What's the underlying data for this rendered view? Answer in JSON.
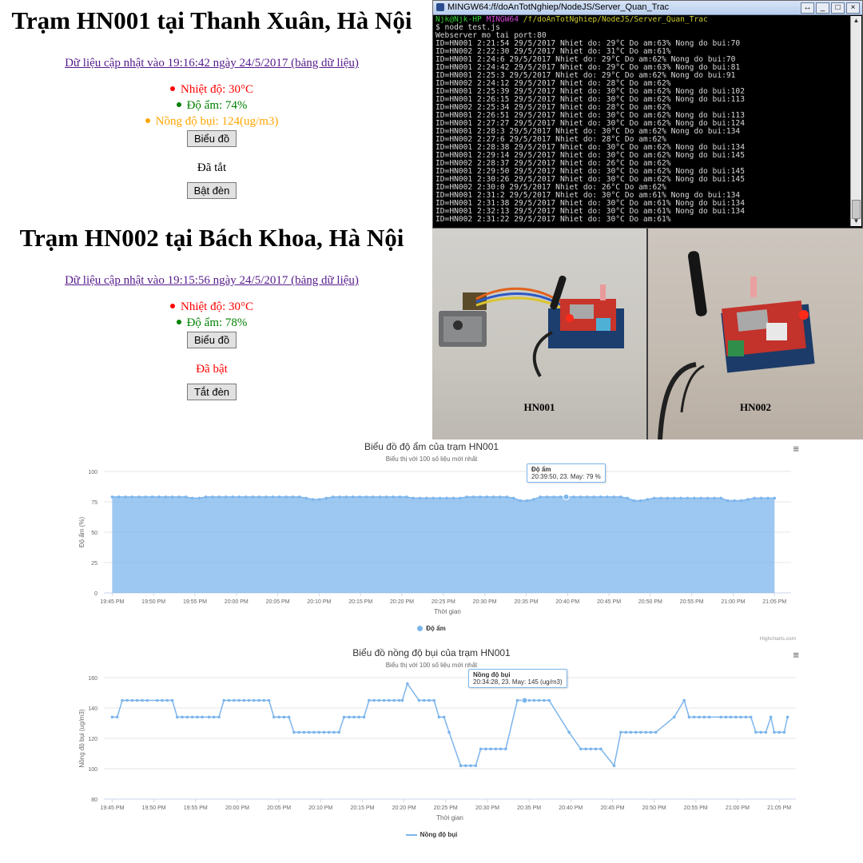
{
  "stations": [
    {
      "title": "Trạm HN001 tại Thanh Xuân, Hà Nội",
      "update_text": "Dữ liệu cập nhật vào 19:16:42 ngày 24/5/2017 (bảng dữ liệu)",
      "metrics": [
        {
          "text": "Nhiệt độ: 30°C",
          "color": "#ff0000"
        },
        {
          "text": "Độ ẩm: 74%",
          "color": "#008000"
        },
        {
          "text": "Nồng độ bụi: 124(ug/m3)",
          "color": "#ffa500"
        }
      ],
      "chart_button": "Biểu đồ",
      "state_text": "Đã tắt",
      "state_color": "#000000",
      "toggle_button": "Bật đèn"
    },
    {
      "title": "Trạm HN002 tại Bách Khoa, Hà Nội",
      "update_text": "Dữ liệu cập nhật vào 19:15:56 ngày 24/5/2017 (bảng dữ liệu)",
      "metrics": [
        {
          "text": "Nhiệt độ: 30°C",
          "color": "#ff0000"
        },
        {
          "text": "Độ ẩm: 78%",
          "color": "#008000"
        }
      ],
      "chart_button": "Biểu đồ",
      "state_text": "Đã bật",
      "state_color": "#ff0000",
      "toggle_button": "Tắt đèn"
    }
  ],
  "terminal": {
    "title": "MINGW64:/f/doAnTotNghiep/NodeJS/Server_Quan_Trac",
    "prompt_user": "Njk@Njk-HP",
    "prompt_host": "MINGW64",
    "prompt_path": "/f/doAnTotNghiep/NodeJS/Server_Quan_Trac",
    "command": "$ node test.js",
    "lines": [
      "Webserver mo tai port:80",
      "ID=HN001 2:21:54 29/5/2017 Nhiet do: 29°C Do am:63% Nong do bui:70",
      "ID=HN002 2:22:30 29/5/2017 Nhiet do: 31°C Do am:61%",
      "ID=HN001 2:24:6 29/5/2017 Nhiet do: 29°C Do am:62% Nong do bui:70",
      "ID=HN001 2:24:42 29/5/2017 Nhiet do: 29°C Do am:63% Nong do bui:81",
      "ID=HN001 2:25:3 29/5/2017 Nhiet do: 29°C Do am:62% Nong do bui:91",
      "ID=HN002 2:24:12 29/5/2017 Nhiet do: 28°C Do am:62%",
      "ID=HN001 2:25:39 29/5/2017 Nhiet do: 30°C Do am:62% Nong do bui:102",
      "ID=HN001 2:26:15 29/5/2017 Nhiet do: 30°C Do am:62% Nong do bui:113",
      "ID=HN002 2:25:34 29/5/2017 Nhiet do: 28°C Do am:62%",
      "ID=HN001 2:26:51 29/5/2017 Nhiet do: 30°C Do am:62% Nong do bui:113",
      "ID=HN001 2:27:27 29/5/2017 Nhiet do: 30°C Do am:62% Nong do bui:124",
      "ID=HN001 2:28:3 29/5/2017 Nhiet do: 30°C Do am:62% Nong do bui:134",
      "ID=HN002 2:27:6 29/5/2017 Nhiet do: 28°C Do am:62%",
      "ID=HN001 2:28:38 29/5/2017 Nhiet do: 30°C Do am:62% Nong do bui:134",
      "ID=HN001 2:29:14 29/5/2017 Nhiet do: 30°C Do am:62% Nong do bui:145",
      "ID=HN002 2:28:37 29/5/2017 Nhiet do: 26°C Do am:62%",
      "ID=HN001 2:29:50 29/5/2017 Nhiet do: 30°C Do am:62% Nong do bui:145",
      "ID=HN001 2:30:26 29/5/2017 Nhiet do: 30°C Do am:62% Nong do bui:145",
      "ID=HN002 2:30:0 29/5/2017 Nhiet do: 26°C Do am:62%",
      "ID=HN001 2:31:2 29/5/2017 Nhiet do: 30°C Do am:61% Nong do bui:134",
      "ID=HN001 2:31:38 29/5/2017 Nhiet do: 30°C Do am:61% Nong do bui:134",
      "ID=HN001 2:32:13 29/5/2017 Nhiet do: 30°C Do am:61% Nong do bui:134",
      "ID=HN002 2:31:22 29/5/2017 Nhiet do: 30°C Do am:61%"
    ]
  },
  "photos": {
    "label_1": "HN001",
    "label_2": "HN002"
  },
  "chart_data": [
    {
      "type": "area",
      "title": "Biểu đồ độ ẩm của trạm HN001",
      "subtitle": "Biểu thị với 100 số liệu mới nhất",
      "xlabel": "Thời gian",
      "ylabel": "Độ ẩm (%)",
      "ylim": [
        0,
        100
      ],
      "yticks": [
        0,
        25,
        50,
        75,
        100
      ],
      "xlim": [
        "19:44",
        "21:07"
      ],
      "xticks": [
        "19:45 PM",
        "19:50 PM",
        "19:55 PM",
        "20:00 PM",
        "20:05 PM",
        "20:10 PM",
        "20:15 PM",
        "20:20 PM",
        "20:25 PM",
        "20:30 PM",
        "20:35 PM",
        "20:40 PM",
        "20:45 PM",
        "20:50 PM",
        "20:55 PM",
        "21:00 PM",
        "21:05 PM"
      ],
      "series": [
        {
          "name": "Độ ẩm",
          "color": "#7cb5ec",
          "start": "19:45",
          "end": "21:05",
          "values": [
            79,
            79,
            79,
            79,
            79,
            79,
            79,
            79,
            79,
            79,
            79,
            79,
            78,
            78,
            79,
            79,
            79,
            79,
            79,
            79,
            79,
            79,
            79,
            79,
            79,
            79,
            79,
            79,
            79,
            78,
            77,
            77,
            78,
            79,
            79,
            79,
            79,
            79,
            79,
            79,
            79,
            79,
            79,
            79,
            79,
            78,
            78,
            78,
            78,
            78,
            78,
            78,
            78,
            79,
            79,
            79,
            79,
            79,
            79,
            79,
            78,
            76,
            76,
            77,
            79,
            79,
            79,
            79,
            79,
            79,
            79,
            79,
            79,
            79,
            79,
            79,
            79,
            78,
            76,
            76,
            77,
            78,
            78,
            78,
            78,
            78,
            78,
            78,
            78,
            78,
            78,
            78,
            76,
            76,
            76,
            77,
            78,
            78,
            78,
            78
          ]
        }
      ],
      "tooltip": {
        "title": "Độ ẩm",
        "text": "20:39:50, 23. May: 79 %",
        "x": "20:39:50",
        "value": 79
      },
      "legend": "Độ ẩm",
      "credit": "Highcharts.com",
      "grid": true
    },
    {
      "type": "line",
      "title": "Biểu đồ nồng độ bụi của trạm HN001",
      "subtitle": "Biểu thị với 100 số liệu mới nhất",
      "xlabel": "Thời gian",
      "ylabel": "Nồng độ bụi (ug/m3)",
      "ylim": [
        80,
        160
      ],
      "yticks": [
        80,
        100,
        120,
        140,
        160
      ],
      "xlim": [
        "19:44",
        "21:07"
      ],
      "xticks": [
        "19:45 PM",
        "19:50 PM",
        "19:55 PM",
        "20:00 PM",
        "20:05 PM",
        "20:10 PM",
        "20:15 PM",
        "20:20 PM",
        "20:25 PM",
        "20:30 PM",
        "20:35 PM",
        "20:40 PM",
        "20:45 PM",
        "20:50 PM",
        "20:55 PM",
        "21:00 PM",
        "21:05 PM"
      ],
      "series": [
        {
          "name": "Nồng độ bụi",
          "color": "#7cb5ec",
          "points": [
            [
              "19:45:00",
              134
            ],
            [
              "19:45:36",
              134
            ],
            [
              "19:46:12",
              145
            ],
            [
              "19:46:48",
              145
            ],
            [
              "19:47:24",
              145
            ],
            [
              "19:48:00",
              145
            ],
            [
              "19:48:36",
              145
            ],
            [
              "19:49:12",
              145
            ],
            [
              "19:50:24",
              145
            ],
            [
              "19:51:00",
              145
            ],
            [
              "19:51:36",
              145
            ],
            [
              "19:52:12",
              145
            ],
            [
              "19:52:48",
              134
            ],
            [
              "19:53:24",
              134
            ],
            [
              "19:54:00",
              134
            ],
            [
              "19:54:36",
              134
            ],
            [
              "19:55:12",
              134
            ],
            [
              "19:55:48",
              134
            ],
            [
              "19:56:36",
              134
            ],
            [
              "19:57:12",
              134
            ],
            [
              "19:57:48",
              134
            ],
            [
              "19:58:24",
              145
            ],
            [
              "19:59:00",
              145
            ],
            [
              "19:59:36",
              145
            ],
            [
              "20:00:12",
              145
            ],
            [
              "20:00:48",
              145
            ],
            [
              "20:01:24",
              145
            ],
            [
              "20:02:00",
              145
            ],
            [
              "20:02:36",
              145
            ],
            [
              "20:03:12",
              145
            ],
            [
              "20:03:48",
              145
            ],
            [
              "20:04:24",
              134
            ],
            [
              "20:05:00",
              134
            ],
            [
              "20:05:36",
              134
            ],
            [
              "20:06:12",
              134
            ],
            [
              "20:06:48",
              124
            ],
            [
              "20:07:24",
              124
            ],
            [
              "20:08:00",
              124
            ],
            [
              "20:08:36",
              124
            ],
            [
              "20:09:12",
              124
            ],
            [
              "20:09:48",
              124
            ],
            [
              "20:10:24",
              124
            ],
            [
              "20:11:00",
              124
            ],
            [
              "20:11:36",
              124
            ],
            [
              "20:12:12",
              124
            ],
            [
              "20:12:48",
              134
            ],
            [
              "20:13:24",
              134
            ],
            [
              "20:14:00",
              134
            ],
            [
              "20:14:36",
              134
            ],
            [
              "20:15:12",
              134
            ],
            [
              "20:15:48",
              145
            ],
            [
              "20:16:24",
              145
            ],
            [
              "20:17:00",
              145
            ],
            [
              "20:17:36",
              145
            ],
            [
              "20:18:12",
              145
            ],
            [
              "20:18:48",
              145
            ],
            [
              "20:19:24",
              145
            ],
            [
              "20:19:48",
              145
            ],
            [
              "20:20:24",
              156
            ],
            [
              "20:21:48",
              145
            ],
            [
              "20:22:24",
              145
            ],
            [
              "20:23:00",
              145
            ],
            [
              "20:23:36",
              145
            ],
            [
              "20:24:12",
              134
            ],
            [
              "20:24:48",
              134
            ],
            [
              "20:25:24",
              124
            ],
            [
              "20:26:48",
              102
            ],
            [
              "20:27:24",
              102
            ],
            [
              "20:28:00",
              102
            ],
            [
              "20:28:36",
              102
            ],
            [
              "20:29:12",
              113
            ],
            [
              "20:29:48",
              113
            ],
            [
              "20:30:24",
              113
            ],
            [
              "20:31:00",
              113
            ],
            [
              "20:31:36",
              113
            ],
            [
              "20:32:12",
              113
            ],
            [
              "20:33:36",
              145
            ],
            [
              "20:34:12",
              145
            ],
            [
              "20:34:28",
              145
            ],
            [
              "20:35:00",
              145
            ],
            [
              "20:35:36",
              145
            ],
            [
              "20:36:12",
              145
            ],
            [
              "20:36:48",
              145
            ],
            [
              "20:37:24",
              145
            ],
            [
              "20:39:48",
              124
            ],
            [
              "20:41:12",
              113
            ],
            [
              "20:41:48",
              113
            ],
            [
              "20:42:24",
              113
            ],
            [
              "20:43:00",
              113
            ],
            [
              "20:43:36",
              113
            ],
            [
              "20:45:12",
              102
            ],
            [
              "20:46:00",
              124
            ],
            [
              "20:46:36",
              124
            ],
            [
              "20:47:12",
              124
            ],
            [
              "20:47:48",
              124
            ],
            [
              "20:48:24",
              124
            ],
            [
              "20:49:00",
              124
            ],
            [
              "20:49:36",
              124
            ],
            [
              "20:50:12",
              124
            ],
            [
              "20:52:24",
              134
            ],
            [
              "20:53:36",
              145
            ],
            [
              "20:54:12",
              134
            ],
            [
              "20:54:48",
              134
            ],
            [
              "20:55:24",
              134
            ],
            [
              "20:56:00",
              134
            ],
            [
              "20:56:36",
              134
            ],
            [
              "20:58:00",
              134
            ],
            [
              "20:58:36",
              134
            ],
            [
              "20:59:12",
              134
            ],
            [
              "20:59:48",
              134
            ],
            [
              "21:00:24",
              134
            ],
            [
              "21:01:00",
              134
            ],
            [
              "21:01:36",
              134
            ],
            [
              "21:02:12",
              124
            ],
            [
              "21:02:48",
              124
            ],
            [
              "21:03:24",
              124
            ],
            [
              "21:04:00",
              134
            ],
            [
              "21:04:24",
              124
            ],
            [
              "21:05:00",
              124
            ],
            [
              "21:05:36",
              124
            ],
            [
              "21:06:00",
              134
            ]
          ]
        }
      ],
      "tooltip": {
        "title": "Nồng độ bụi",
        "text": "20:34:28, 23. May: 145 (ug/m3)",
        "x": "20:34:28",
        "value": 145
      },
      "legend": "Nồng độ bụi",
      "grid": true
    }
  ]
}
